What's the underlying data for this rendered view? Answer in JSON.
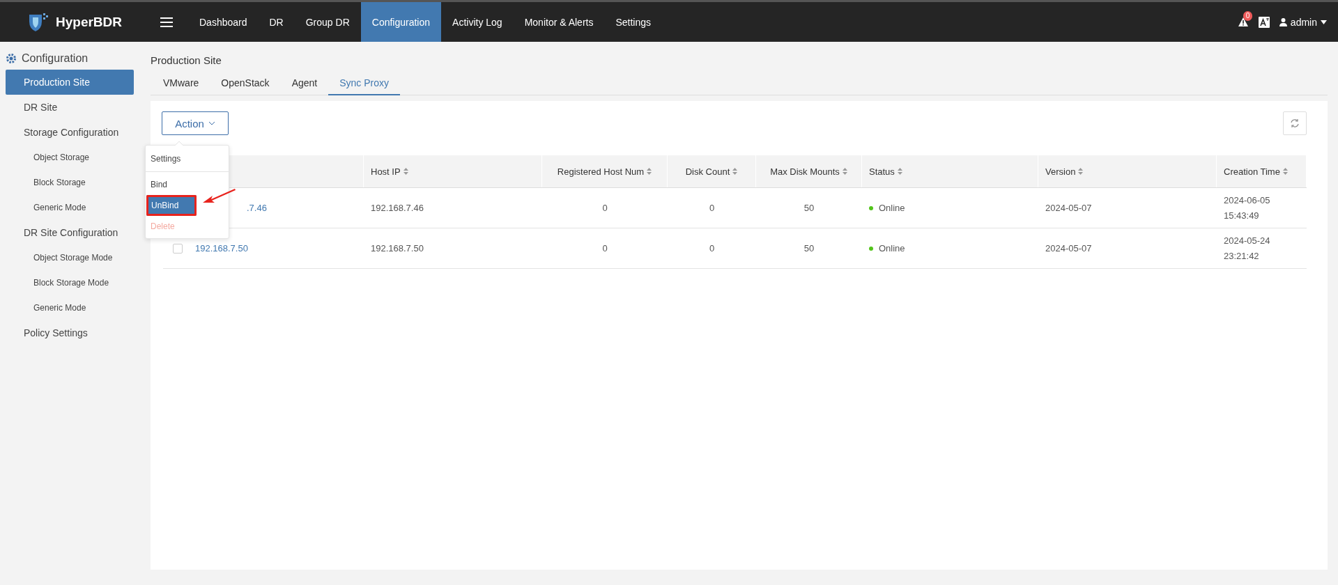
{
  "header": {
    "brand": "HyperBDR",
    "nav": [
      {
        "label": "Dashboard",
        "selected": false
      },
      {
        "label": "DR",
        "selected": false
      },
      {
        "label": "Group DR",
        "selected": false
      },
      {
        "label": "Configuration",
        "selected": true
      },
      {
        "label": "Activity Log",
        "selected": false
      },
      {
        "label": "Monitor & Alerts",
        "selected": false
      },
      {
        "label": "Settings",
        "selected": false
      }
    ],
    "alert_count": "0",
    "user": "admin"
  },
  "sidebar": {
    "title": "Configuration",
    "items": [
      {
        "label": "Production Site",
        "selected": true
      },
      {
        "label": "DR Site",
        "selected": false
      },
      {
        "label": "Storage Configuration",
        "selected": false,
        "children": [
          {
            "label": "Object Storage",
            "selected": false
          },
          {
            "label": "Block Storage",
            "selected": false
          },
          {
            "label": "Generic Mode",
            "selected": false
          }
        ]
      },
      {
        "label": "DR Site Configuration",
        "selected": false,
        "children": [
          {
            "label": "Object Storage Mode",
            "selected": false
          },
          {
            "label": "Block Storage Mode",
            "selected": false
          },
          {
            "label": "Generic Mode",
            "selected": false
          }
        ]
      },
      {
        "label": "Policy Settings",
        "selected": false
      }
    ]
  },
  "page_title": "Production Site",
  "tabs": [
    {
      "label": "VMware",
      "selected": false
    },
    {
      "label": "OpenStack",
      "selected": false
    },
    {
      "label": "Agent",
      "selected": false
    },
    {
      "label": "Sync Proxy",
      "selected": true
    }
  ],
  "action_button": "Action",
  "action_menu": [
    {
      "label": "Settings",
      "selected": false,
      "disabled": false,
      "separator": true,
      "annotated": false
    },
    {
      "label": "Bind",
      "selected": false,
      "disabled": false,
      "separator": false,
      "annotated": false
    },
    {
      "label": "UnBind",
      "selected": true,
      "disabled": false,
      "separator": false,
      "annotated": true
    },
    {
      "label": "Delete",
      "selected": false,
      "disabled": true,
      "separator": false,
      "annotated": false
    }
  ],
  "table": {
    "columns": [
      "Host IP",
      "Registered Host Num",
      "Disk Count",
      "Max Disk Mounts",
      "Status",
      "Version",
      "Creation Time"
    ],
    "rows": [
      {
        "name": ".7.46",
        "cells": [
          "192.168.7.46",
          "0",
          "0",
          "50"
        ],
        "status": "Online",
        "color": "#52c41a",
        "version": "2024-05-07",
        "created": "2024-06-05 15:43:49"
      },
      {
        "name": "192.168.7.50",
        "checked": false,
        "cells": [
          "192.168.7.50",
          "0",
          "0",
          "50"
        ],
        "status": "Online",
        "color": "#52c41a",
        "version": "2024-05-07",
        "created": "2024-05-24 23:21:42"
      }
    ]
  }
}
